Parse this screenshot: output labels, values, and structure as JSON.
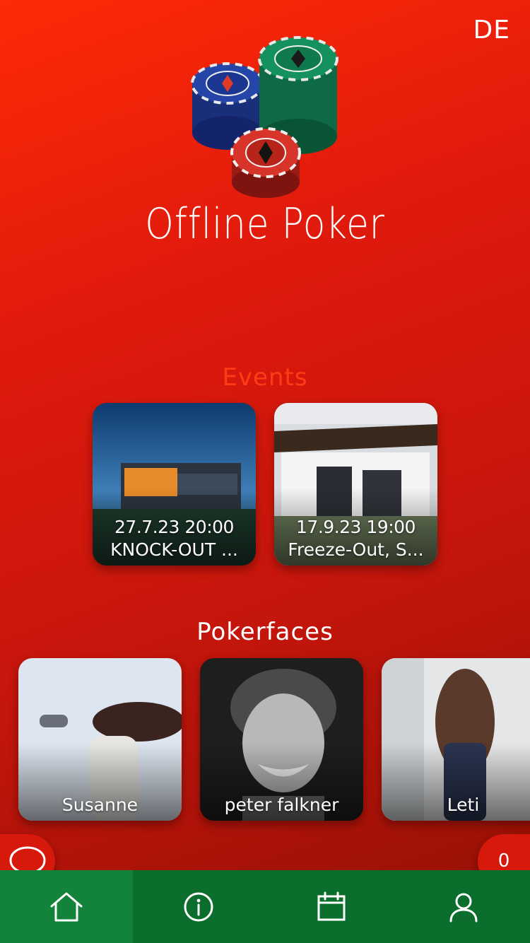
{
  "header": {
    "language": "DE"
  },
  "app": {
    "title": "Offline Poker"
  },
  "events": {
    "title": "Events",
    "items": [
      {
        "date": "27.7.23 20:00",
        "name": "KNOCK-OUT ..."
      },
      {
        "date": "17.9.23 19:00",
        "name": "Freeze-Out, S..."
      }
    ]
  },
  "pokerfaces": {
    "title": "Pokerfaces",
    "items": [
      {
        "name": "Susanne"
      },
      {
        "name": "peter falkner"
      },
      {
        "name": "Leti"
      }
    ]
  },
  "fab": {
    "chat_icon": "chat-bubble-icon",
    "count": "0"
  },
  "tabbar": {
    "items": [
      {
        "icon": "home-icon",
        "active": true
      },
      {
        "icon": "info-icon",
        "active": false
      },
      {
        "icon": "calendar-icon",
        "active": false
      },
      {
        "icon": "user-icon",
        "active": false
      }
    ]
  },
  "colors": {
    "background_top": "#ff2a06",
    "background_bottom": "#8f1006",
    "events_title": "#ff3b16",
    "tabbar": "#0c6e2c",
    "tabbar_active": "#13823a",
    "fab": "#d7190c"
  }
}
